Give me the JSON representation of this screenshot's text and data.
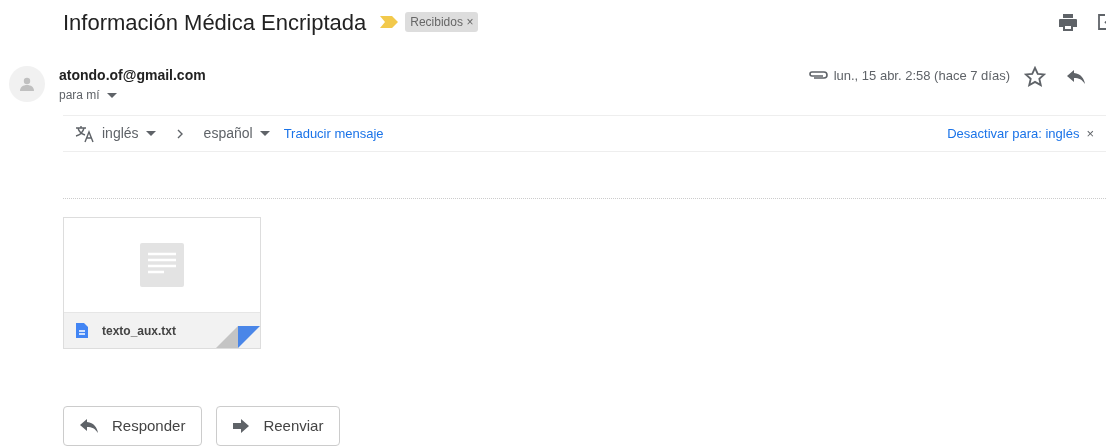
{
  "subject": "Información Médica Encriptada",
  "label": {
    "text": "Recibidos",
    "close": "×"
  },
  "sender": {
    "email": "atondo.of@gmail.com",
    "recipient": "para mí",
    "date": "lun., 15 abr. 2:58 (hace 7 días)",
    "starred": false
  },
  "translate_bar": {
    "from": "inglés",
    "to": "español",
    "translate_link": "Traducir mensaje",
    "disable_link": "Desactivar para: inglés",
    "close": "×"
  },
  "attachments": [
    {
      "name": "texto_aux.txt"
    }
  ],
  "buttons": [
    {
      "kind": "reply",
      "label": "Responder"
    },
    {
      "kind": "forward",
      "label": "Reenviar"
    }
  ]
}
